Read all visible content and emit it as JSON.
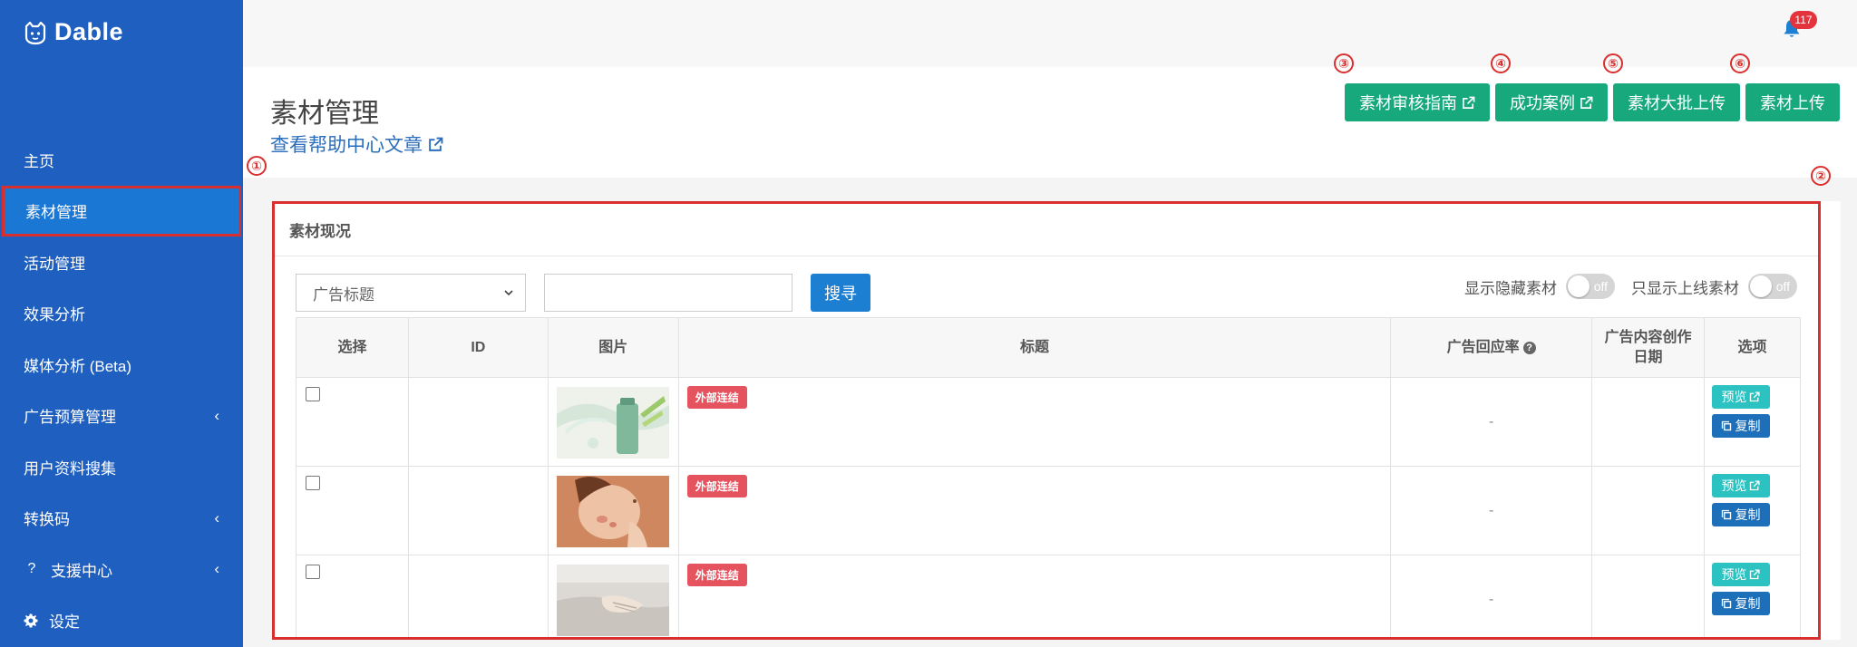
{
  "brand": {
    "name": "Dable"
  },
  "sidebar": {
    "items": [
      {
        "label": "主页",
        "chevron": false
      },
      {
        "label": "素材管理",
        "chevron": false,
        "active": true
      },
      {
        "label": "活动管理",
        "chevron": false
      },
      {
        "label": "效果分析",
        "chevron": false
      },
      {
        "label": "媒体分析 (Beta)",
        "chevron": false
      },
      {
        "label": "广告预算管理",
        "chevron": true
      },
      {
        "label": "用户资料搜集",
        "chevron": false
      },
      {
        "label": "转换码",
        "chevron": true
      },
      {
        "label": "支援中心",
        "chevron": true,
        "icon": "?"
      },
      {
        "label": "设定",
        "chevron": false,
        "icon": "gear-icon"
      }
    ]
  },
  "topbar": {
    "notification_count": "117"
  },
  "header": {
    "title": "素材管理",
    "help_link": "查看帮助中心文章",
    "buttons": {
      "review_guide": "素材审核指南",
      "success_cases": "成功案例",
      "bulk_upload": "素材大批上传",
      "upload": "素材上传"
    }
  },
  "annotations": {
    "a1": "①",
    "a2": "②",
    "a3": "③",
    "a4": "④",
    "a5": "⑤",
    "a6": "⑥"
  },
  "panel": {
    "title": "素材现况",
    "select_value": "广告标题",
    "search_value": "",
    "search_button": "搜寻",
    "toggle_hidden_label": "显示隐藏素材",
    "toggle_online_label": "只显示上线素材",
    "toggle_state": "off"
  },
  "table": {
    "headers": {
      "select": "选择",
      "id": "ID",
      "image": "图片",
      "title": "标题",
      "ctr": "广告回应率",
      "created_line1": "广告内容创作",
      "created_line2": "日期",
      "options": "选项"
    },
    "rows": [
      {
        "tag": "外部连结",
        "ctr": "-",
        "preview": "预览",
        "copy": "复制"
      },
      {
        "tag": "外部连结",
        "ctr": "-",
        "preview": "预览",
        "copy": "复制"
      },
      {
        "tag": "外部连结",
        "ctr": "-",
        "preview": "预览",
        "copy": "复制"
      }
    ]
  },
  "colors": {
    "sidebar": "#1e5fc0",
    "accent_green": "#17a97c",
    "primary_blue": "#1d7fd1",
    "highlight_red": "#d9302f",
    "tag_red": "#e5535f",
    "preview_teal": "#2bc2c1"
  }
}
